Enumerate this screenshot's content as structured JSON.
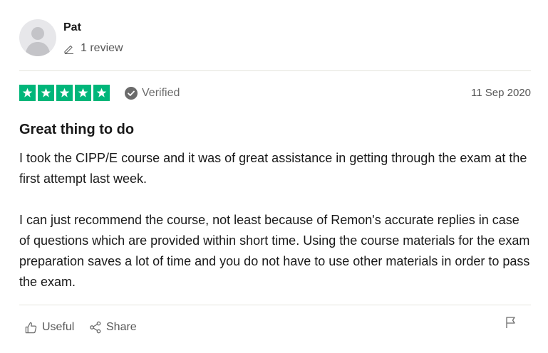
{
  "reviewer": {
    "name": "Pat",
    "review_count": "1 review"
  },
  "rating": {
    "stars": 5,
    "max": 5,
    "star_color": "#00b67a"
  },
  "verified_label": "Verified",
  "date": "11 Sep 2020",
  "review": {
    "title": "Great thing to do",
    "paragraphs": [
      "I took the CIPP/E course and it was of great assistance in getting through the exam at the first attempt last week.",
      "I can just recommend the course, not least because of Remon's accurate replies in case of questions which are provided within short time. Using the course materials for the exam preparation saves a lot of time and you do not have to use other materials in order to pass the exam."
    ]
  },
  "actions": {
    "useful_label": "Useful",
    "share_label": "Share"
  },
  "icons": [
    "avatar-placeholder",
    "pencil-icon",
    "star-icon",
    "verified-check-icon",
    "thumbs-up-icon",
    "share-icon",
    "flag-icon"
  ]
}
